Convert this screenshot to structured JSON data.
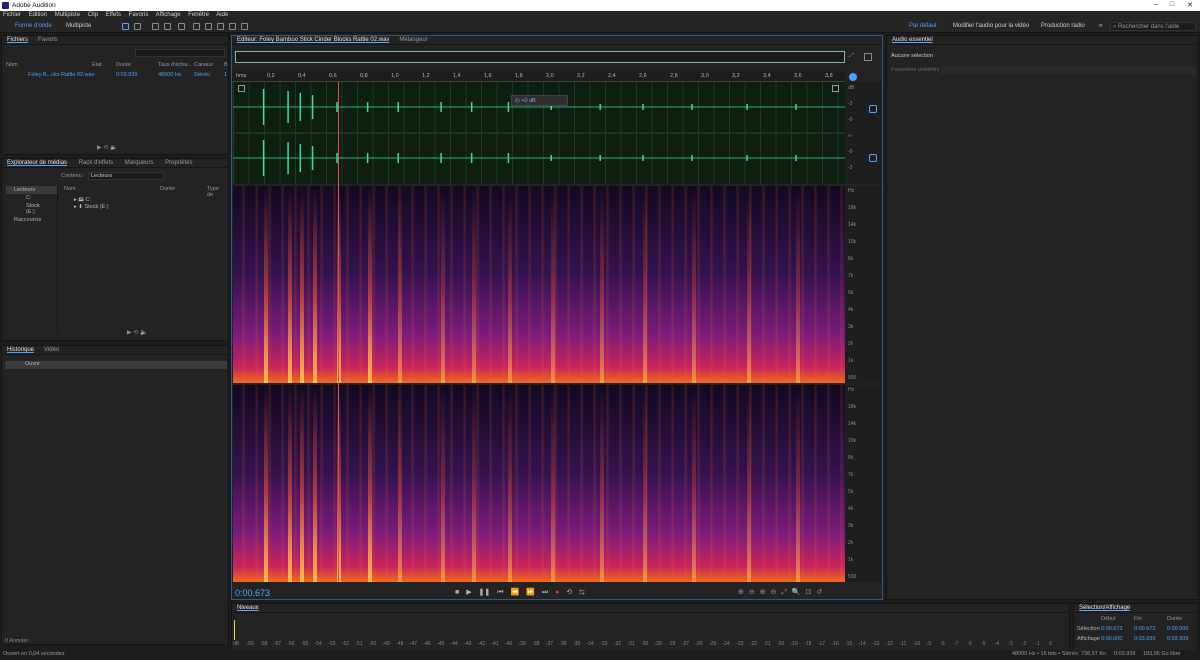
{
  "app": {
    "title": "Adobe Audition"
  },
  "menu": [
    "Fichier",
    "Edition",
    "Multipiste",
    "Clip",
    "Effets",
    "Favoris",
    "Affichage",
    "Fenêtre",
    "Aide"
  ],
  "toolbar": {
    "waveform_label": "Forme d'onde",
    "multitrack_label": "Multipiste"
  },
  "workspaces": {
    "default_label": "Par défaut",
    "clarify_label": "Modifier l'audio pour la vidéo",
    "radio_label": "Production radio",
    "search_placeholder": "Rechercher dans l'aide"
  },
  "files": {
    "tab": "Fichiers",
    "tab2": "Favoris",
    "cols": [
      "Nom",
      "Etat",
      "Durée",
      "Taux d'écha...",
      "Canaux",
      "B"
    ],
    "row": {
      "name": "Foley B...cks Rattle 02.wav",
      "duration": "0:03.939",
      "rate": "48000 Hz",
      "channels": "Stéréo",
      "bits": "1"
    }
  },
  "media": {
    "tabs": [
      "Explorateur de médias",
      "Rack d'effets",
      "Marqueurs",
      "Propriétés"
    ],
    "content_label": "Contenu :",
    "content_value": "Lecteurs",
    "tree": [
      "Lecteurs",
      "C:",
      "Stock (E:)",
      "Raccourcis"
    ],
    "cols": [
      "Nom",
      "Durée",
      "Type de"
    ],
    "items": [
      "C:",
      "Stock (E:)"
    ]
  },
  "history": {
    "tabs": [
      "Historique",
      "Vidéo"
    ],
    "item": "Ouvrir",
    "undo": "0 Annuler",
    "status": "Ouvert en 0,04 secondes"
  },
  "editor": {
    "tab": "Editeur: Foley Bamboo Stick Cinder Blocks Rattle 02.wav",
    "tab2": "Mélangeur",
    "time": "0:00.673",
    "ruler": [
      "hms",
      "0,2",
      "0,4",
      "0,6",
      "0,8",
      "1,0",
      "1,2",
      "1,4",
      "1,6",
      "1,8",
      "2,0",
      "2,2",
      "2,4",
      "2,6",
      "2,8",
      "3,0",
      "3,2",
      "3,4",
      "3,6",
      "3,8"
    ],
    "volume": "+0 dB",
    "playhead_fraction": 0.171
  },
  "db_scale": [
    "dB",
    "-3",
    "-9",
    "∞",
    "-9",
    "-3"
  ],
  "freq_scale": [
    "Hz",
    "18k",
    "14k",
    "10k",
    "8k",
    "7k",
    "5k",
    "4k",
    "3k",
    "2k",
    "1k",
    "500"
  ],
  "essential": {
    "title": "Audio essentiel",
    "none": "Aucune sélection",
    "preset": "Paramètre prédéfini :"
  },
  "levels": {
    "title": "Niveaux",
    "ticks": [
      "dB",
      "-59",
      "-58",
      "-57",
      "-56",
      "-55",
      "-54",
      "-53",
      "-52",
      "-51",
      "-50",
      "-49",
      "-48",
      "-47",
      "-46",
      "-45",
      "-44",
      "-43",
      "-42",
      "-41",
      "-40",
      "-39",
      "-38",
      "-37",
      "-36",
      "-35",
      "-34",
      "-33",
      "-32",
      "-31",
      "-30",
      "-29",
      "-28",
      "-27",
      "-26",
      "-25",
      "-24",
      "-23",
      "-22",
      "-21",
      "-20",
      "-19",
      "-18",
      "-17",
      "-16",
      "-15",
      "-14",
      "-13",
      "-12",
      "-11",
      "-10",
      "-9",
      "-8",
      "-7",
      "-6",
      "-5",
      "-4",
      "-3",
      "-2",
      "-1",
      "0"
    ]
  },
  "selection": {
    "title": "Sélection/Affichage",
    "cols": [
      "Début",
      "Fin",
      "Durée"
    ],
    "rows": [
      {
        "label": "Sélection",
        "start": "0:00.673",
        "end": "0:00.673",
        "dur": "0:00.000"
      },
      {
        "label": "Affichage",
        "start": "0:00.000",
        "end": "0:03.939",
        "dur": "0:03.939"
      }
    ]
  },
  "statusbar": {
    "format": "48000 Hz • 16 bits • Stéréo",
    "size": "738,57 Ko",
    "duration": "0:03.939",
    "free": "183,95 Go libre"
  },
  "colors": {
    "accent": "#4da3ff",
    "waveform": "#3fd9a4",
    "record": "#e03a2e"
  }
}
